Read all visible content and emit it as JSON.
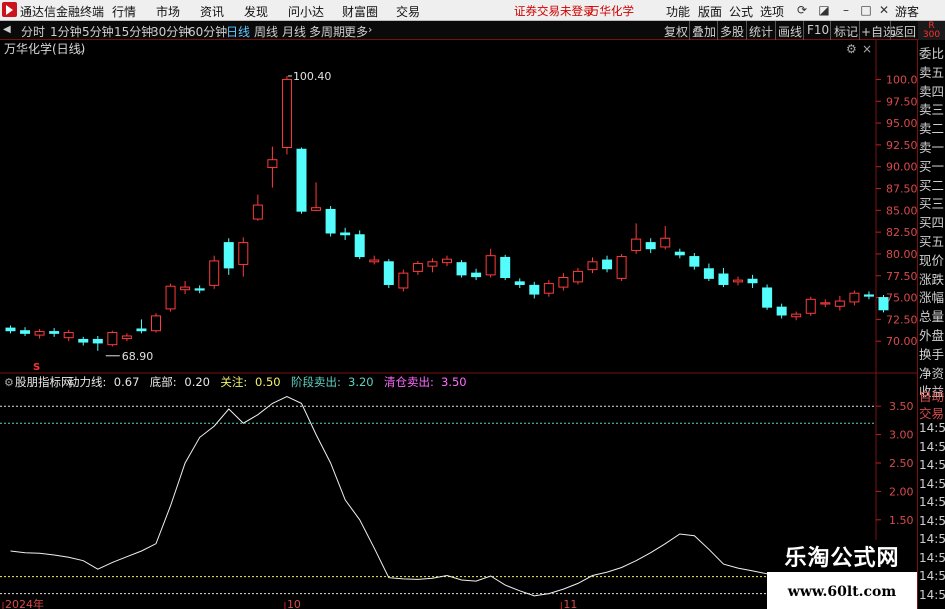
{
  "menubar": {
    "app_name": "通达信金融终端",
    "menus": [
      "行情",
      "市场",
      "资讯",
      "发现",
      "问小达",
      "财富圈",
      "交易"
    ],
    "status_text": "证券交易未登录",
    "stock_name": "万华化学",
    "right_menus": [
      "功能",
      "版面",
      "公式",
      "选项"
    ],
    "guest": "游客"
  },
  "toolbar": {
    "periods": [
      "分时",
      "1分钟",
      "5分钟",
      "15分钟",
      "30分钟",
      "60分钟",
      "日线",
      "周线",
      "月线",
      "多周期",
      "更多"
    ],
    "active_period": "日线",
    "right_buttons": [
      "复权",
      "叠加",
      "多股",
      "统计",
      "画线",
      "F10",
      "标记",
      "+自选",
      "返回"
    ],
    "badge_top": "R",
    "badge_bottom": "300"
  },
  "chart_data": [
    {
      "type": "candlestick",
      "title": "万华化学(日线)",
      "ylim": [
        67.5,
        102.0
      ],
      "yticks": [
        70.0,
        72.5,
        75.0,
        77.5,
        80.0,
        82.5,
        85.0,
        87.5,
        90.0,
        92.5,
        95.0,
        97.5,
        100.0
      ],
      "annotations": {
        "high": "100.40",
        "low": "68.90"
      },
      "colors": {
        "up": "#ff3b3b",
        "down": "#54fcfc"
      },
      "candles": [
        {
          "o": 71.5,
          "c": 71.2,
          "h": 71.8,
          "l": 70.9
        },
        {
          "o": 71.2,
          "c": 70.9,
          "h": 71.6,
          "l": 70.6
        },
        {
          "o": 70.7,
          "c": 71.1,
          "h": 71.4,
          "l": 70.3
        },
        {
          "o": 71.1,
          "c": 70.9,
          "h": 71.5,
          "l": 70.5
        },
        {
          "o": 70.4,
          "c": 71.0,
          "h": 71.3,
          "l": 70.0
        },
        {
          "o": 70.2,
          "c": 69.9,
          "h": 70.5,
          "l": 69.5
        },
        {
          "o": 70.2,
          "c": 69.8,
          "h": 70.6,
          "l": 68.9
        },
        {
          "o": 69.6,
          "c": 71.0,
          "h": 71.2,
          "l": 69.4
        },
        {
          "o": 70.3,
          "c": 70.6,
          "h": 70.9,
          "l": 70.0
        },
        {
          "o": 71.4,
          "c": 71.2,
          "h": 72.5,
          "l": 70.9
        },
        {
          "o": 71.2,
          "c": 72.9,
          "h": 73.2,
          "l": 71.0
        },
        {
          "o": 73.7,
          "c": 76.3,
          "h": 76.6,
          "l": 73.4
        },
        {
          "o": 75.9,
          "c": 76.2,
          "h": 76.9,
          "l": 75.4
        },
        {
          "o": 76.0,
          "c": 75.9,
          "h": 76.4,
          "l": 75.5
        },
        {
          "o": 76.4,
          "c": 79.2,
          "h": 79.8,
          "l": 76.0
        },
        {
          "o": 81.3,
          "c": 78.4,
          "h": 81.8,
          "l": 77.6
        },
        {
          "o": 78.8,
          "c": 81.3,
          "h": 81.9,
          "l": 77.4
        },
        {
          "o": 84.0,
          "c": 85.6,
          "h": 86.8,
          "l": 83.8
        },
        {
          "o": 89.9,
          "c": 90.8,
          "h": 92.3,
          "l": 87.6
        },
        {
          "o": 92.2,
          "c": 100.0,
          "h": 100.4,
          "l": 91.4
        },
        {
          "o": 92.0,
          "c": 84.9,
          "h": 92.2,
          "l": 84.6
        },
        {
          "o": 85.0,
          "c": 85.3,
          "h": 88.2,
          "l": 84.9
        },
        {
          "o": 85.1,
          "c": 82.4,
          "h": 85.5,
          "l": 82.0
        },
        {
          "o": 82.4,
          "c": 82.2,
          "h": 83.0,
          "l": 81.6
        },
        {
          "o": 82.2,
          "c": 79.7,
          "h": 82.7,
          "l": 79.4
        },
        {
          "o": 79.1,
          "c": 79.3,
          "h": 79.8,
          "l": 78.8
        },
        {
          "o": 79.1,
          "c": 76.5,
          "h": 79.4,
          "l": 76.1
        },
        {
          "o": 76.1,
          "c": 77.8,
          "h": 78.2,
          "l": 75.7
        },
        {
          "o": 78.0,
          "c": 78.9,
          "h": 79.2,
          "l": 77.6
        },
        {
          "o": 78.6,
          "c": 79.1,
          "h": 79.5,
          "l": 77.9
        },
        {
          "o": 79.0,
          "c": 79.4,
          "h": 79.8,
          "l": 78.6
        },
        {
          "o": 79.0,
          "c": 77.6,
          "h": 79.3,
          "l": 77.3
        },
        {
          "o": 77.8,
          "c": 77.4,
          "h": 78.3,
          "l": 77.0
        },
        {
          "o": 77.6,
          "c": 79.8,
          "h": 80.6,
          "l": 77.3
        },
        {
          "o": 79.6,
          "c": 77.3,
          "h": 79.9,
          "l": 77.0
        },
        {
          "o": 76.8,
          "c": 76.5,
          "h": 77.2,
          "l": 76.1
        },
        {
          "o": 76.4,
          "c": 75.4,
          "h": 76.8,
          "l": 74.9
        },
        {
          "o": 75.5,
          "c": 76.6,
          "h": 77.0,
          "l": 75.1
        },
        {
          "o": 76.2,
          "c": 77.3,
          "h": 77.8,
          "l": 75.8
        },
        {
          "o": 76.8,
          "c": 78.0,
          "h": 78.4,
          "l": 76.5
        },
        {
          "o": 78.2,
          "c": 79.1,
          "h": 79.6,
          "l": 77.8
        },
        {
          "o": 79.3,
          "c": 78.3,
          "h": 79.8,
          "l": 77.9
        },
        {
          "o": 77.2,
          "c": 79.7,
          "h": 80.0,
          "l": 76.9
        },
        {
          "o": 80.4,
          "c": 81.7,
          "h": 83.5,
          "l": 80.0
        },
        {
          "o": 81.3,
          "c": 80.6,
          "h": 81.8,
          "l": 80.1
        },
        {
          "o": 80.8,
          "c": 81.8,
          "h": 83.2,
          "l": 80.5
        },
        {
          "o": 80.2,
          "c": 79.9,
          "h": 80.6,
          "l": 79.5
        },
        {
          "o": 79.7,
          "c": 78.6,
          "h": 80.1,
          "l": 78.2
        },
        {
          "o": 78.3,
          "c": 77.2,
          "h": 78.9,
          "l": 76.9
        },
        {
          "o": 77.7,
          "c": 76.5,
          "h": 78.4,
          "l": 76.2
        },
        {
          "o": 76.8,
          "c": 77.0,
          "h": 77.4,
          "l": 76.4
        },
        {
          "o": 77.1,
          "c": 76.7,
          "h": 77.6,
          "l": 76.1
        },
        {
          "o": 76.1,
          "c": 73.9,
          "h": 76.5,
          "l": 73.6
        },
        {
          "o": 73.9,
          "c": 73.0,
          "h": 74.3,
          "l": 72.6
        },
        {
          "o": 72.8,
          "c": 73.1,
          "h": 73.4,
          "l": 72.4
        },
        {
          "o": 73.2,
          "c": 74.8,
          "h": 75.1,
          "l": 72.9
        },
        {
          "o": 74.3,
          "c": 74.4,
          "h": 74.8,
          "l": 73.9
        },
        {
          "o": 74.0,
          "c": 74.6,
          "h": 75.2,
          "l": 73.5
        },
        {
          "o": 74.5,
          "c": 75.5,
          "h": 75.8,
          "l": 74.1
        },
        {
          "o": 75.3,
          "c": 75.2,
          "h": 75.7,
          "l": 74.8
        },
        {
          "o": 75.0,
          "c": 73.6,
          "h": 75.3,
          "l": 73.3
        }
      ]
    },
    {
      "type": "line",
      "title": "股朋指标网",
      "legend": [
        {
          "label": "动力线:",
          "value": "0.67",
          "color": "#e8e8e8"
        },
        {
          "label": "底部:",
          "value": "0.20",
          "color": "#e8e8e8"
        },
        {
          "label": "关注:",
          "value": "0.50",
          "color": "#f0f06a"
        },
        {
          "label": "阶段卖出:",
          "value": "3.20",
          "color": "#5fd1c0"
        },
        {
          "label": "清仓卖出:",
          "value": "3.50",
          "color": "#ff6bff"
        }
      ],
      "ylim": [
        0.0,
        3.75
      ],
      "yticks": [
        0.5,
        1.0,
        1.5,
        2.0,
        2.5,
        3.0,
        3.5
      ],
      "hlines": [
        {
          "value": 3.5,
          "color": "#e0e0e0"
        },
        {
          "value": 3.2,
          "color": "#5fd1c0"
        },
        {
          "value": 0.5,
          "color": "#f0f06a"
        },
        {
          "value": 0.2,
          "color": "#e0e0e0"
        }
      ],
      "x_labels": [
        {
          "label": "2024年",
          "index": 0
        },
        {
          "label": "10",
          "index": 19
        },
        {
          "label": "11",
          "index": 38
        }
      ],
      "values": [
        0.95,
        0.92,
        0.91,
        0.88,
        0.84,
        0.78,
        0.63,
        0.75,
        0.85,
        0.95,
        1.08,
        1.75,
        2.5,
        2.95,
        3.15,
        3.45,
        3.2,
        3.35,
        3.55,
        3.67,
        3.55,
        3.0,
        2.5,
        1.85,
        1.5,
        1.0,
        0.48,
        0.46,
        0.45,
        0.47,
        0.52,
        0.44,
        0.42,
        0.51,
        0.35,
        0.25,
        0.16,
        0.2,
        0.28,
        0.38,
        0.52,
        0.58,
        0.66,
        0.78,
        0.92,
        1.08,
        1.25,
        1.22,
        0.98,
        0.72,
        0.65,
        0.6,
        0.55,
        0.42,
        0.33,
        0.25,
        0.22,
        0.2,
        0.17,
        0.16,
        0.18
      ]
    }
  ],
  "right_panel": {
    "items": [
      "委比",
      "卖五",
      "卖四",
      "卖三",
      "卖二",
      "卖一",
      "买一",
      "买二",
      "买三",
      "买四",
      "买五",
      "现价",
      "涨跌",
      "涨幅",
      "总量",
      "外盘",
      "换手",
      "净资",
      "收益"
    ],
    "auto_label": "自动",
    "trade_label": "交易",
    "times": [
      "14:56",
      "14:56",
      "14:56",
      "14:56",
      "14:56",
      "14:56",
      "14:56",
      "14:56",
      "14:56",
      "14:56"
    ]
  },
  "watermark": {
    "title": "乐淘公式网",
    "url": "www.60lt.com"
  }
}
